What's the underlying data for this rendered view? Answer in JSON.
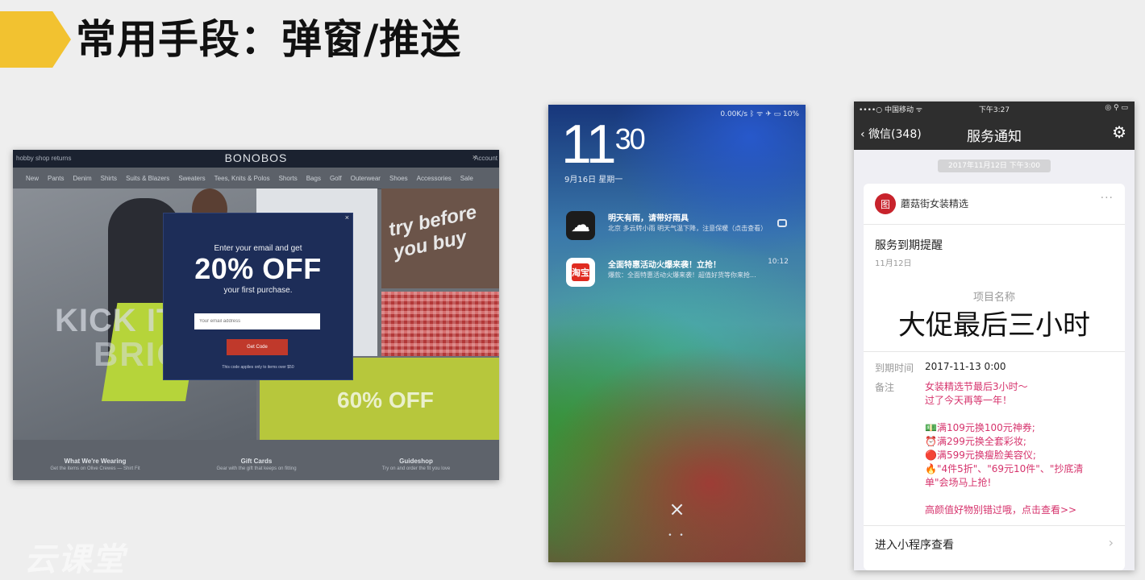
{
  "slide": {
    "title": "常用手段：弹窗/推送",
    "accent_color": "#f2c230"
  },
  "website": {
    "topbar_note": "hobby shop returns",
    "logo": "BONOBOS",
    "close_glyph": "×",
    "account": "Account",
    "nav": [
      "New",
      "Pants",
      "Denim",
      "Shirts",
      "Suits & Blazers",
      "Sweaters",
      "Tees, Knits & Polos",
      "Shorts",
      "Bags",
      "Golf",
      "Outerwear",
      "Shoes",
      "Accessories",
      "Sale"
    ],
    "hero_text_1": "KICK IT",
    "hero_text_2": "BRIGHT",
    "hero_text_3": "try before you buy",
    "promo_text": "60% OFF",
    "footer": [
      {
        "title": "What We're Wearing",
        "sub": "Get the items on Olive Crewes — Shirt Fit"
      },
      {
        "title": "Gift Cards",
        "sub": "Gear with the gift that keeps on fitting"
      },
      {
        "title": "Guideshop",
        "sub": "Try on and order the fit you love"
      }
    ],
    "popup": {
      "close": "×",
      "line1": "Enter your email and get",
      "headline": "20% OFF",
      "line2": "your first purchase.",
      "email_placeholder": "Your email address",
      "button": "Get Code",
      "fine_print": "This code applies only to items over $50"
    }
  },
  "lockscreen": {
    "status": "0.00K/s  ᛒ  ᯤ  ✈  ▭  10%",
    "time_hour": "11",
    "time_min": "30",
    "date": "9月16日 星期一",
    "notifications": [
      {
        "icon": "weather-cloud-icon",
        "glyph": "",
        "title": "明天有雨，请带好雨具",
        "body": "北京 多云转小雨 明天气温下降，注意保暖（点击查看）",
        "right": ""
      },
      {
        "icon": "taobao-icon",
        "glyph": "淘宝",
        "title": "全面特惠活动火爆来袭！立抢！",
        "body": "爆款：全面特惠活动火爆来袭！超值好货等你来抢...",
        "right": "10:12"
      }
    ],
    "close_glyph": "×",
    "dots": "• •"
  },
  "wechat": {
    "status_carrier": "••••○ 中国移动 ᯤ",
    "status_time": "下午3:27",
    "status_right": "◎ ⚲ ▭",
    "back_label": "微信(348)",
    "title": "服务通知",
    "timestamp": "2017年11月12日 下午3:00",
    "brand": "蘑菇街女装精选",
    "more": "···",
    "subject": "服务到期提醒",
    "subject_date": "11月12日",
    "project_label": "项目名称",
    "project_name": "大促最后三小时",
    "due_key": "到期时间",
    "due_value": "2017-11-13 0:00",
    "remark_key": "备注",
    "remark_lines_1": [
      "女装精选节最后3小时～",
      "过了今天再等一年！"
    ],
    "remark_lines_2": [
      "💵满109元换100元神券;",
      "⏰满299元换全套彩妆;",
      "🔴满599元换瘦脸美容仪;",
      "🔥\"4件5折\"、\"69元10件\"、\"抄底清",
      "单\"会场马上抢!"
    ],
    "remark_lines_3": [
      "高颜值好物别错过哦，点击查看>>"
    ],
    "footer_link": "进入小程序查看",
    "chevron": "›"
  },
  "watermark": "云课堂"
}
